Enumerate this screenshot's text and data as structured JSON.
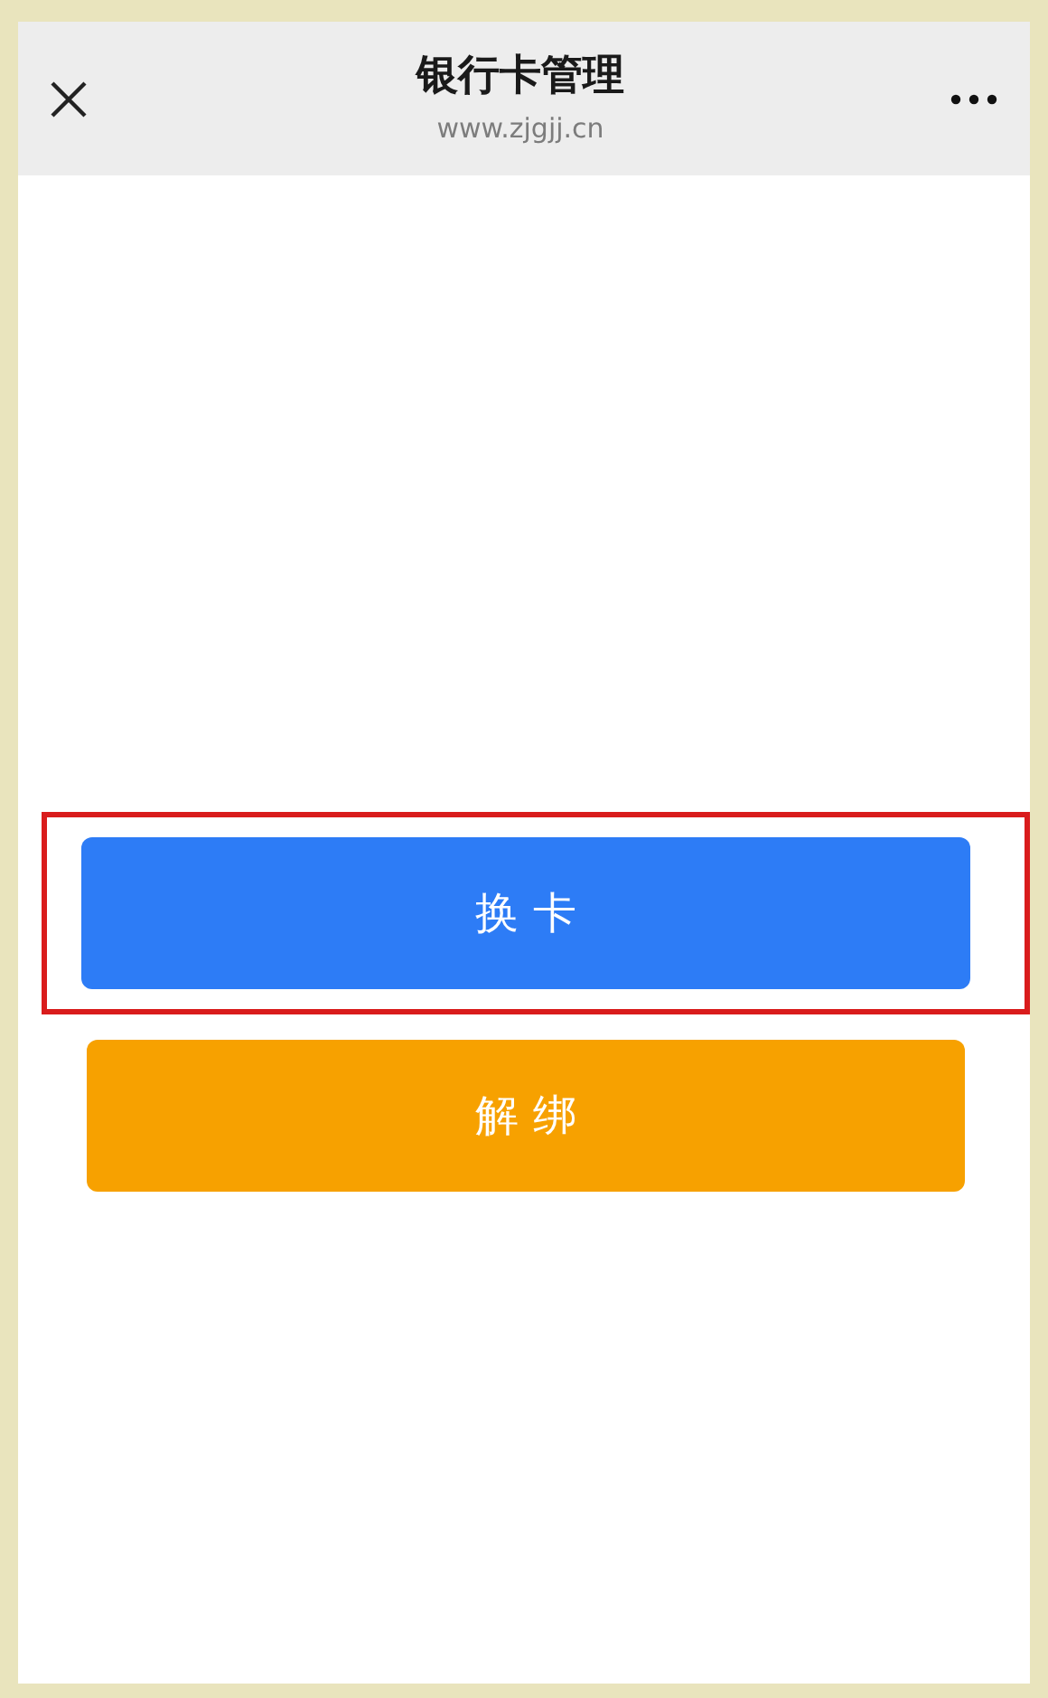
{
  "header": {
    "title": "银行卡管理",
    "subtitle": "www.zjgjj.cn"
  },
  "buttons": [
    {
      "label": "换 卡",
      "kind": "primary",
      "highlighted": true
    },
    {
      "label": "解 绑",
      "kind": "warning",
      "highlighted": false
    }
  ]
}
